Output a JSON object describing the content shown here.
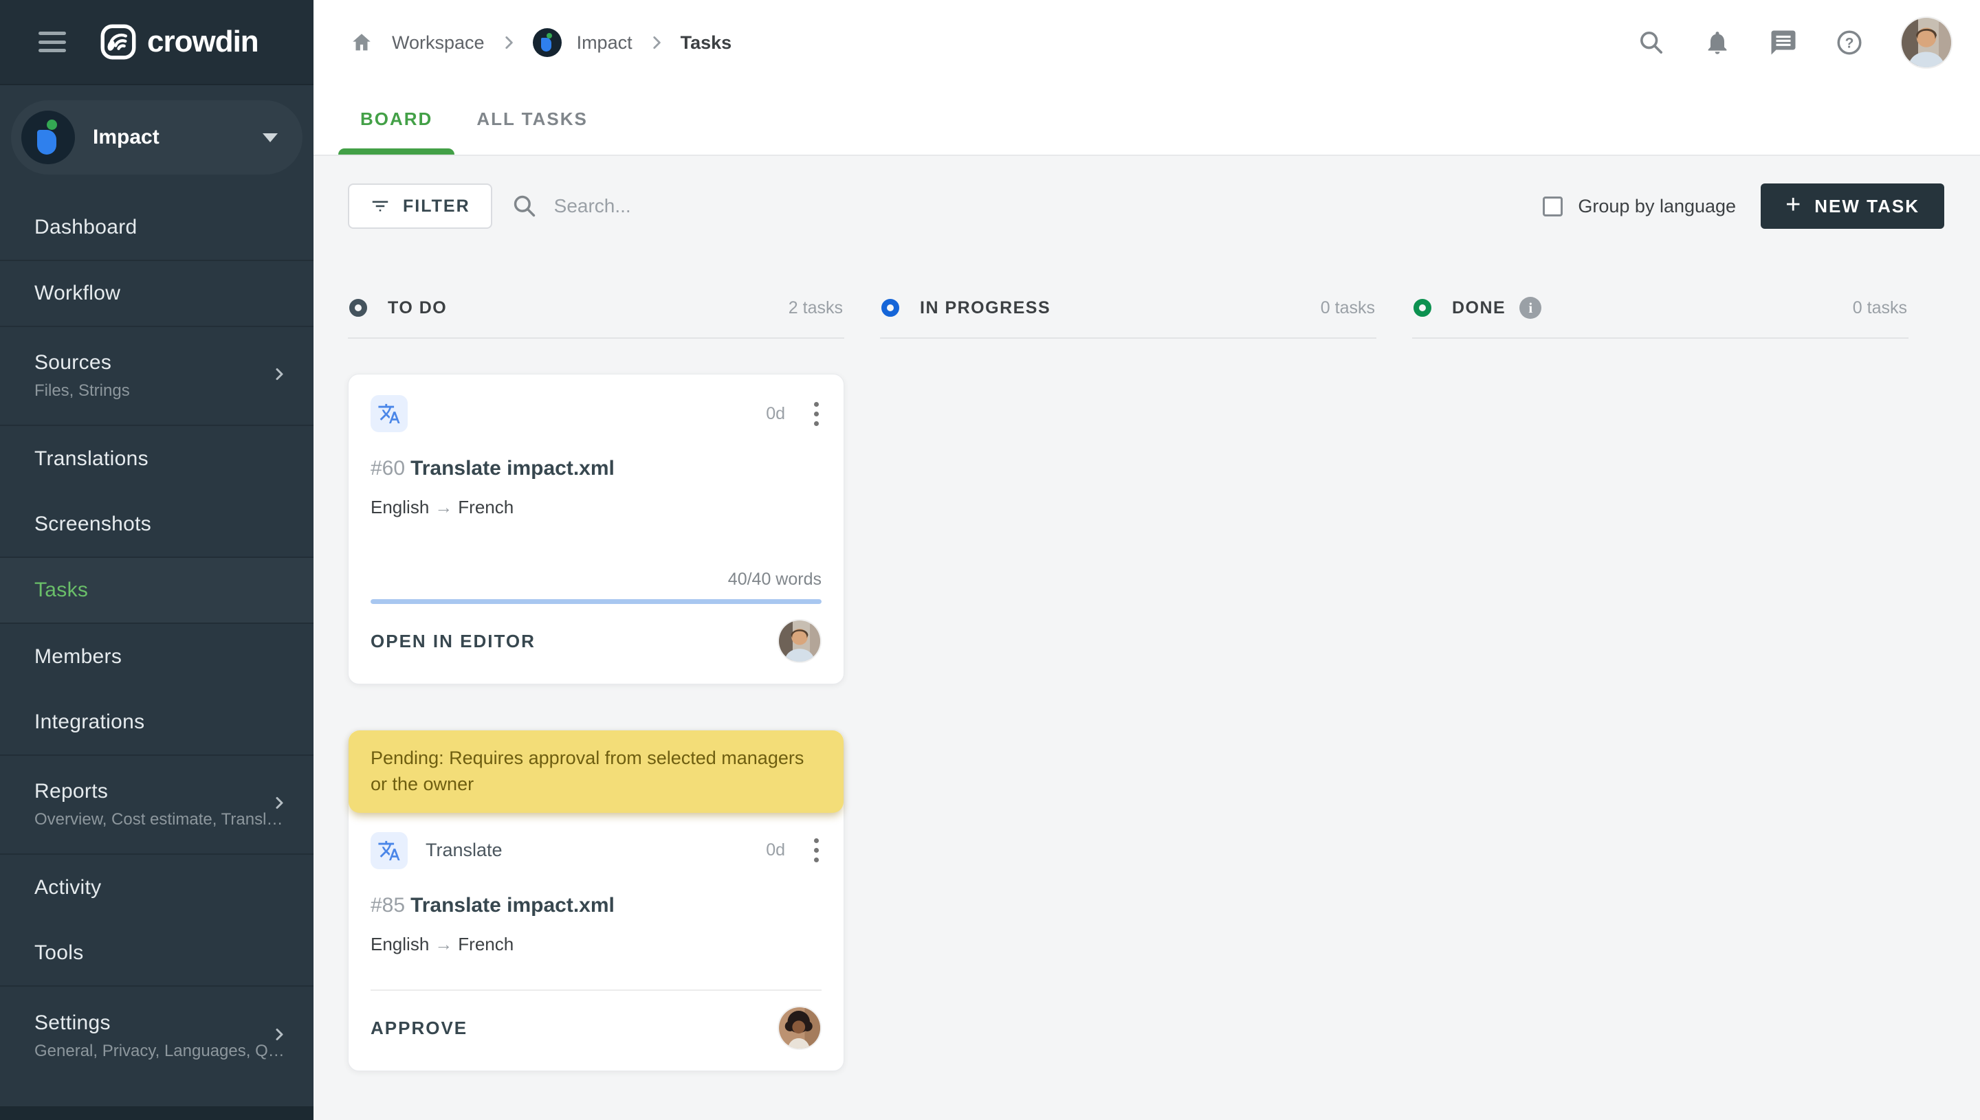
{
  "brand": {
    "name": "crowdin"
  },
  "sidebar": {
    "project": {
      "name": "Impact"
    },
    "items": [
      {
        "label": "Dashboard"
      },
      {
        "label": "Workflow"
      },
      {
        "label": "Sources",
        "subtitle": "Files, Strings"
      },
      {
        "label": "Translations"
      },
      {
        "label": "Screenshots"
      },
      {
        "label": "Tasks"
      },
      {
        "label": "Members"
      },
      {
        "label": "Integrations"
      },
      {
        "label": "Reports",
        "subtitle": "Overview, Cost estimate, Transl…"
      },
      {
        "label": "Activity"
      },
      {
        "label": "Tools"
      },
      {
        "label": "Settings",
        "subtitle": "General, Privacy, Languages, Q…"
      }
    ]
  },
  "breadcrumb": {
    "workspace": "Workspace",
    "project": "Impact",
    "page": "Tasks"
  },
  "tabs": {
    "board": "BOARD",
    "all_tasks": "ALL TASKS"
  },
  "toolbar": {
    "filter": "FILTER",
    "search_placeholder": "Search...",
    "group_by": "Group by language",
    "new_task": "NEW TASK",
    "new_task_plus": "+"
  },
  "columns": [
    {
      "title": "TO DO",
      "count": "2 tasks"
    },
    {
      "title": "IN PROGRESS",
      "count": "0 tasks"
    },
    {
      "title": "DONE",
      "count": "0 tasks",
      "info": "i"
    }
  ],
  "cards": {
    "first": {
      "duration": "0d",
      "number": "#60",
      "title": "Translate impact.xml",
      "lang_from": "English",
      "lang_arrow": "→",
      "lang_to": "French",
      "words": "40/40 words",
      "progress_percent": 100,
      "action": "OPEN IN EDITOR"
    },
    "second": {
      "banner": "Pending: Requires approval from selected managers or the owner",
      "type": "Translate",
      "duration": "0d",
      "number": "#85",
      "title": "Translate impact.xml",
      "lang_from": "English",
      "lang_arrow": "→",
      "lang_to": "French",
      "action": "APPROVE"
    }
  },
  "colors": {
    "accent_green": "#43a047",
    "sidebar_bg": "#2a3842",
    "todo_ring": "#44535d",
    "in_progress_ring": "#1565d8",
    "done_ring": "#0c9150",
    "banner_bg": "#f3dd78",
    "banner_text": "#6e5e10",
    "progress_bar": "#a8c7f0",
    "new_task_bg": "#26343c"
  }
}
